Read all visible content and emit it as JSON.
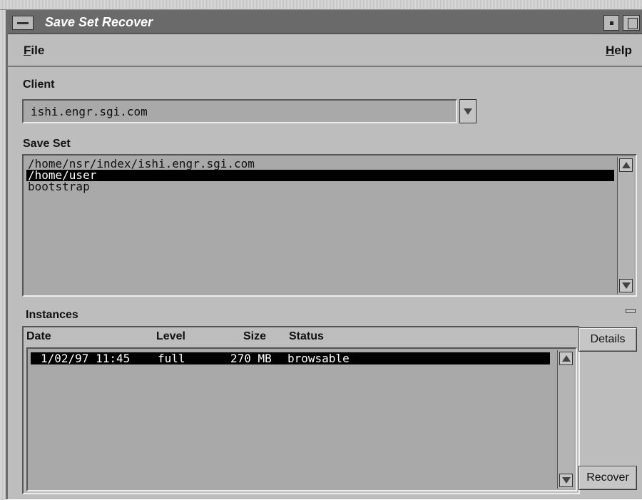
{
  "window": {
    "title": "Save Set Recover"
  },
  "menubar": {
    "file": {
      "mnemonic": "F",
      "rest": "ile"
    },
    "help": {
      "mnemonic": "H",
      "rest": "elp"
    }
  },
  "client": {
    "label": "Client",
    "value": "ishi.engr.sgi.com"
  },
  "save_set": {
    "label": "Save Set",
    "items": [
      {
        "text": "/home/nsr/index/ishi.engr.sgi.com",
        "selected": false
      },
      {
        "text": "/home/user",
        "selected": true
      },
      {
        "text": "bootstrap",
        "selected": false
      }
    ]
  },
  "instances": {
    "label": "Instances",
    "columns": {
      "date": "Date",
      "level": "Level",
      "size": "Size",
      "status": "Status"
    },
    "rows": [
      {
        "date": "1/02/97 11:45",
        "level": "full",
        "size": "270 MB",
        "status": "browsable",
        "selected": true
      }
    ]
  },
  "buttons": {
    "details": "Details",
    "recover": "Recover"
  },
  "icons": {
    "window_menu": "window-menu-icon",
    "minimize": "minimize-icon",
    "maximize": "maximize-icon",
    "dropdown": "triangle-down-icon",
    "scroll_up": "triangle-up-icon",
    "scroll_down": "triangle-down-icon"
  }
}
